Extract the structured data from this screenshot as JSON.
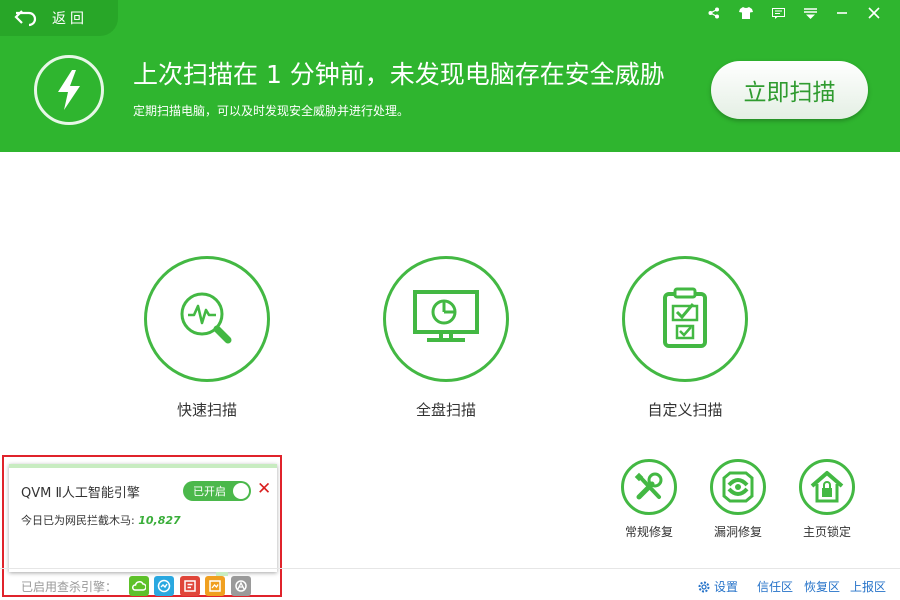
{
  "header": {
    "back_label": "返回",
    "headline": "上次扫描在 1 分钟前，未发现电脑存在安全威胁",
    "subline": "定期扫描电脑，可以及时发现安全威胁并进行处理。",
    "scan_button": "立即扫描",
    "top_icons": [
      "share-icon",
      "shirt-icon",
      "message-icon",
      "menu-icon",
      "minimize-icon",
      "close-icon"
    ]
  },
  "scan_modes": [
    {
      "label": "快速扫描",
      "icon": "quick-scan-icon"
    },
    {
      "label": "全盘扫描",
      "icon": "monitor-icon"
    },
    {
      "label": "自定义扫描",
      "icon": "checklist-icon"
    }
  ],
  "tools": [
    {
      "label": "常规修复",
      "icon": "tools-icon"
    },
    {
      "label": "漏洞修复",
      "icon": "shield-repair-icon"
    },
    {
      "label": "主页锁定",
      "icon": "home-lock-icon"
    }
  ],
  "qvm_panel": {
    "title": "QVM Ⅱ人工智能引擎",
    "toggle_label": "已开启",
    "close": "✕",
    "today_label": "今日已为网民拦截木马: ",
    "today_count": "10,827"
  },
  "status_bar": {
    "engines_label": "已启用查杀引擎：",
    "engines": [
      {
        "icon": "cloud-engine-icon",
        "color": "#5ec12a"
      },
      {
        "icon": "qvm-engine-icon",
        "color": "#2aa8e0"
      },
      {
        "icon": "system-repair-engine-icon",
        "color": "#e0463a"
      },
      {
        "icon": "local-engine-icon",
        "color": "#f0a020"
      },
      {
        "icon": "avira-engine-icon",
        "color": "#9a9a9a"
      }
    ],
    "links": {
      "settings": "设置",
      "trust": "信任区",
      "restore": "恢复区",
      "report": "上报区"
    }
  },
  "colors": {
    "brand_green": "#2fb52f",
    "accent_green": "#43b843",
    "highlight_red": "#e0232b",
    "link_blue": "#2673c9"
  }
}
